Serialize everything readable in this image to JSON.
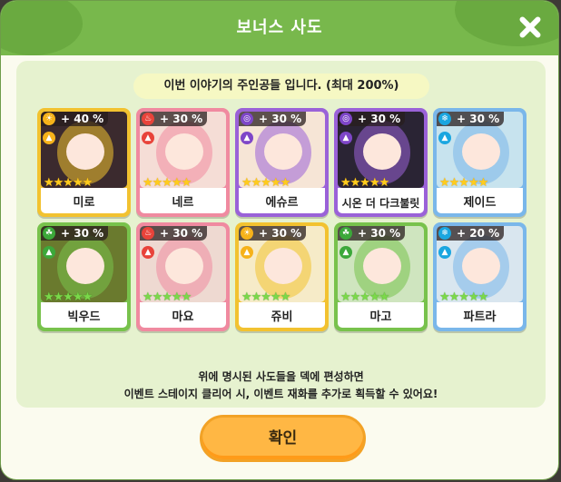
{
  "dialog": {
    "title": "보너스 사도",
    "close_icon": "close-icon",
    "subtitle": "이번 이야기의 주인공들 입니다. (최대 200%)",
    "note_line1": "위에 명시된 사도들을 덱에 편성하면",
    "note_line2": "이벤트 스테이지 클리어 시, 이벤트 재화를 추가로 획득할 수 있어요!",
    "confirm_label": "확인"
  },
  "cards": [
    {
      "name": "미로",
      "bonus": "+ 40 %",
      "element": "light",
      "frame": "#f2c230",
      "bg": "#3b2a2e",
      "stars": 5,
      "star_color": "gold",
      "class": "attacker-icon"
    },
    {
      "name": "네르",
      "bonus": "+ 30 %",
      "element": "fire",
      "frame": "#f08aa0",
      "bg": "#f5ddd6",
      "stars": 5,
      "star_color": "gold",
      "class": "attacker-icon"
    },
    {
      "name": "에슈르",
      "bonus": "+ 30 %",
      "element": "dark",
      "frame": "#9a62d8",
      "bg": "#f6e5d6",
      "stars": 5,
      "star_color": "gold",
      "class": "mage-icon"
    },
    {
      "name": "시온 더 다크불릿",
      "bonus": "+ 30 %",
      "element": "dark",
      "frame": "#9a62d8",
      "bg": "#2a2434",
      "stars": 5,
      "star_color": "gold",
      "class": "attacker-icon"
    },
    {
      "name": "제이드",
      "bonus": "+ 30 %",
      "element": "water",
      "frame": "#7ab7ea",
      "bg": "#c7e3ee",
      "stars": 5,
      "star_color": "gold",
      "class": "supporter-icon"
    },
    {
      "name": "빅우드",
      "bonus": "+ 30 %",
      "element": "nature",
      "frame": "#78c24c",
      "bg": "#6a7a2e",
      "stars": 5,
      "star_color": "green",
      "class": "defender-icon"
    },
    {
      "name": "마요",
      "bonus": "+ 30 %",
      "element": "fire",
      "frame": "#f08aa0",
      "bg": "#eed9d1",
      "stars": 5,
      "star_color": "green",
      "class": "mage-icon"
    },
    {
      "name": "쥬비",
      "bonus": "+ 30 %",
      "element": "light",
      "frame": "#f2c230",
      "bg": "#f6ebc8",
      "stars": 5,
      "star_color": "green",
      "class": "defender-icon"
    },
    {
      "name": "마고",
      "bonus": "+ 30 %",
      "element": "nature",
      "frame": "#78c24c",
      "bg": "#cfe5bf",
      "stars": 5,
      "star_color": "green",
      "class": "supporter-icon"
    },
    {
      "name": "파트라",
      "bonus": "+ 20 %",
      "element": "water",
      "frame": "#7ab7ea",
      "bg": "#d9e6ef",
      "stars": 5,
      "star_color": "green",
      "class": "attacker-icon"
    }
  ],
  "element_colors": {
    "light": "#f6b21a",
    "fire": "#e8433a",
    "dark": "#7e46c8",
    "water": "#1aa6e0",
    "nature": "#3ca83a"
  }
}
